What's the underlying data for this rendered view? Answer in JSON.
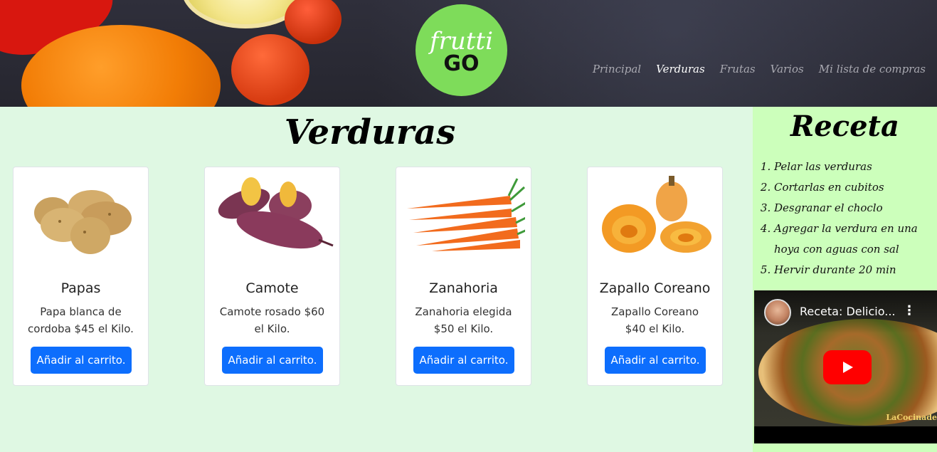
{
  "logo": {
    "top": "frutti",
    "bottom": "GO"
  },
  "nav": {
    "items": [
      {
        "label": "Principal"
      },
      {
        "label": "Verduras"
      },
      {
        "label": "Frutas"
      },
      {
        "label": "Varios"
      },
      {
        "label": "Mi lista de compras"
      }
    ]
  },
  "main": {
    "title": "Verduras",
    "cards": [
      {
        "title": "Papas",
        "text": "Papa blanca de cordoba $45 el Kilo.",
        "button": "Añadir al carrito."
      },
      {
        "title": "Camote",
        "text": "Camote rosado $60 el Kilo.",
        "button": "Añadir al carrito."
      },
      {
        "title": "Zanahoria",
        "text": "Zanahoria elegida $50 el Kilo.",
        "button": "Añadir al carrito."
      },
      {
        "title": "Zapallo Coreano",
        "text": "Zapallo Coreano $40 el Kilo.",
        "button": "Añadir al carrito."
      }
    ]
  },
  "sidebar": {
    "title": "Receta",
    "steps": [
      "Pelar las verduras",
      "Cortarlas en cubitos",
      "Desgranar el choclo",
      "Agregar la verdura en una hoya con aguas con sal",
      "Hervir durante 20 min"
    ],
    "video": {
      "title": "Receta: Delicio...",
      "watermark": "LaCocinade"
    }
  },
  "colors": {
    "accent": "#0d6efd",
    "logo": "#7edc5a",
    "page_bg": "#dff8e3",
    "sidebar_bg": "#ccffbb"
  }
}
